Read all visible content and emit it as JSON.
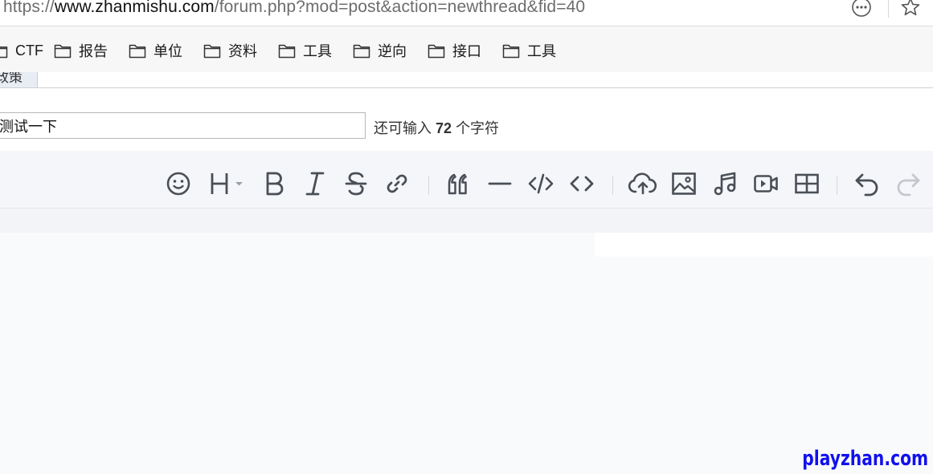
{
  "browser": {
    "url_scheme": "https://",
    "url_domain": "www.zhanmishu.com",
    "url_path": "/forum.php?mod=post&action=newthread&fid=40",
    "icons": [
      "more-options-icon",
      "favorite-star-icon"
    ]
  },
  "bookmarks": {
    "items": [
      {
        "label": "CTF",
        "icon": "folder-icon"
      },
      {
        "label": "报告",
        "icon": "folder-icon"
      },
      {
        "label": "单位",
        "icon": "folder-icon"
      },
      {
        "label": "资料",
        "icon": "folder-icon"
      },
      {
        "label": "工具",
        "icon": "folder-icon"
      },
      {
        "label": "逆向",
        "icon": "folder-icon"
      },
      {
        "label": "接口",
        "icon": "folder-icon"
      },
      {
        "label": "工具",
        "icon": "folder-icon"
      }
    ]
  },
  "tab": {
    "label": "政策"
  },
  "post": {
    "subject_value": "测试一下",
    "counter_prefix": "还可输入",
    "counter_value": "72",
    "counter_suffix": "个字符"
  },
  "toolbar": {
    "buttons": [
      "emoji-icon",
      "heading-icon",
      "bold-icon",
      "italic-icon",
      "strikethrough-icon",
      "link-icon",
      "quote-icon",
      "horizontal-rule-icon",
      "inline-code-icon",
      "code-block-icon",
      "upload-icon",
      "image-icon",
      "music-icon",
      "video-icon",
      "table-icon",
      "undo-icon",
      "redo-icon"
    ]
  },
  "watermark": {
    "text": "playzhan.com"
  },
  "colors": {
    "toolbar_icon": "#4a4f57",
    "toolbar_icon_disabled": "#c4c7cd",
    "watermark": "#1111ee"
  }
}
